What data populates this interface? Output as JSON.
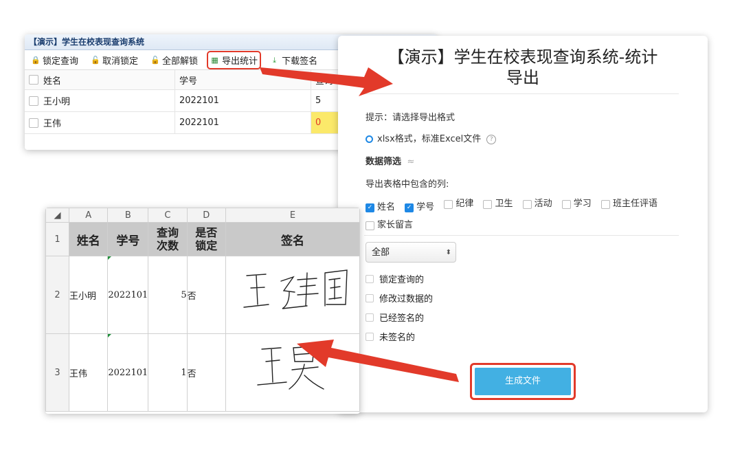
{
  "app": {
    "title": "【演示】学生在校表现查询系统",
    "toolbar": [
      {
        "icon": "lock-icon",
        "glyph": "🔒",
        "label": "锁定查询"
      },
      {
        "icon": "unlock-icon",
        "glyph": "🔓",
        "label": "取消锁定"
      },
      {
        "icon": "unlock-all-icon",
        "glyph": "🔓",
        "label": "全部解锁"
      },
      {
        "icon": "excel-icon",
        "glyph": "▦",
        "label": "导出统计"
      },
      {
        "icon": "download-icon",
        "glyph": "⤓",
        "label": "下载签名"
      }
    ],
    "table": {
      "headers": [
        "姓名",
        "学号",
        "查询"
      ],
      "rows": [
        {
          "name": "王小明",
          "id": "2022101",
          "count": "5"
        },
        {
          "name": "王伟",
          "id": "2022101",
          "count": "0"
        }
      ]
    }
  },
  "dialog": {
    "title_line1": "【演示】学生在校表现查询系统-统计",
    "title_line2": "导出",
    "hint": "提示：请选择导出格式",
    "format_option": "xlsx格式，标准Excel文件",
    "help": "?",
    "filter_heading": "数据筛选",
    "filter_caret": "≈",
    "columns_label": "导出表格中包含的列:",
    "columns": [
      {
        "label": "姓名",
        "checked": true
      },
      {
        "label": "学号",
        "checked": true
      },
      {
        "label": "纪律",
        "checked": false
      },
      {
        "label": "卫生",
        "checked": false
      },
      {
        "label": "活动",
        "checked": false
      },
      {
        "label": "学习",
        "checked": false
      },
      {
        "label": "班主任评语",
        "checked": false
      },
      {
        "label": "家长留言",
        "checked": false
      }
    ],
    "select_value": "全部",
    "select_arrow": "⬍",
    "filters": [
      "锁定查询的",
      "修改过数据的",
      "已经签名的",
      "未签名的"
    ],
    "generate_button": "生成文件"
  },
  "sheet": {
    "col_letters": [
      "A",
      "B",
      "C",
      "D",
      "E"
    ],
    "row_numbers": [
      "1",
      "2",
      "3"
    ],
    "header": {
      "name": "姓名",
      "id": "学号",
      "count_l1": "查询",
      "count_l2": "次数",
      "locked_l1": "是否",
      "locked_l2": "锁定",
      "signature": "签名"
    },
    "rows": [
      {
        "name": "王小明",
        "id": "2022101",
        "count": "5",
        "locked": "否",
        "signature": "王建国"
      },
      {
        "name": "王伟",
        "id": "2022101",
        "count": "1",
        "locked": "否",
        "signature": "王昊"
      }
    ]
  },
  "colors": {
    "highlight": "#e23a2a",
    "accent": "#1e88e5",
    "button": "#42b0e3"
  }
}
